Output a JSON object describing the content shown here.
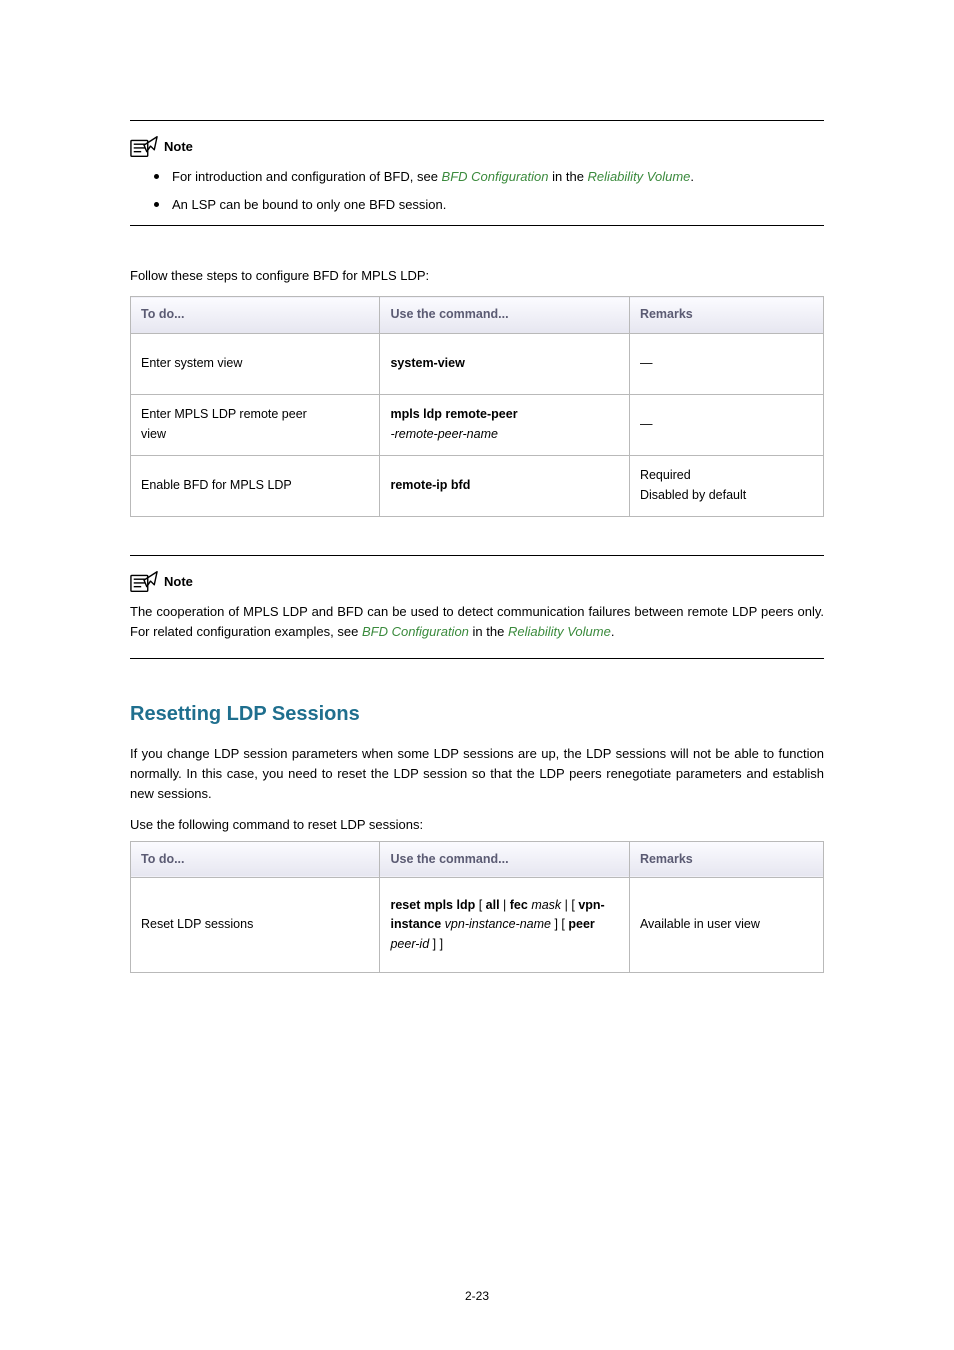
{
  "note1": {
    "label": "Note",
    "bullets": [
      {
        "prefix": "For introduction and configuration of BFD, see ",
        "linkA": "BFD Configuration",
        "mid": " in the ",
        "linkB": "Reliability Volume",
        "suffix": "."
      },
      {
        "text": "An LSP can be bound to only one BFD session."
      }
    ]
  },
  "section1": {
    "intro": "Follow these steps to configure BFD for MPLS LDP:",
    "headers": {
      "c1": "To do...",
      "c2": "Use the command...",
      "c3": "Remarks"
    },
    "rows": [
      {
        "c1": "Enter system view",
        "c2_bold": "system-view",
        "c3_dash": "—"
      },
      {
        "c1a": "Enter MPLS LDP remote peer",
        "c1b": "view",
        "c2_bold": "mpls ldp remote-peer",
        "c2_ital": "remote-peer-name",
        "c2_sep": " ",
        "c3_dash": "—"
      },
      {
        "c1": "Enable BFD for MPLS LDP",
        "c2_bold": "remote-ip bfd",
        "c3a": "Required",
        "c3b": "Disabled by default"
      }
    ]
  },
  "note2": {
    "label": "Note",
    "para_prefix": "The cooperation of MPLS LDP and BFD can be used to detect communication failures between remote LDP peers only. For related configuration examples, see ",
    "linkA": "BFD Configuration",
    "mid": " in the ",
    "linkB": "Reliability Volume",
    "suffix": "."
  },
  "section2": {
    "heading": "Resetting LDP Sessions",
    "para": "If you change LDP session parameters when some LDP sessions are up, the LDP sessions will not be able to function normally. In this case, you need to reset the LDP session so that the LDP peers renegotiate parameters and establish new sessions.",
    "intro": "Use the following command to reset LDP sessions:",
    "headers": {
      "c1": "To do...",
      "c2": "Use the command...",
      "c3": "Remarks"
    },
    "row": {
      "c1": "Reset LDP sessions",
      "c3": "Available in user view"
    },
    "cmd": {
      "p1_b": "reset mpls ldp",
      "p2_t": " [ ",
      "p3_b": "all",
      "p4_t": " | ",
      "p5_b": "fec",
      "p6_t": " ",
      "p7_i": "mask",
      "p8_t": " | [ ",
      "p9_b": "vpn-instance",
      "p10_t": " ",
      "p11_i": "vpn-instance-name",
      "p12_t": " ] [ ",
      "p13_b": "peer",
      "p14_i": "peer-id",
      "p15_t": " ] ]"
    }
  },
  "pageNumber": "2-23"
}
